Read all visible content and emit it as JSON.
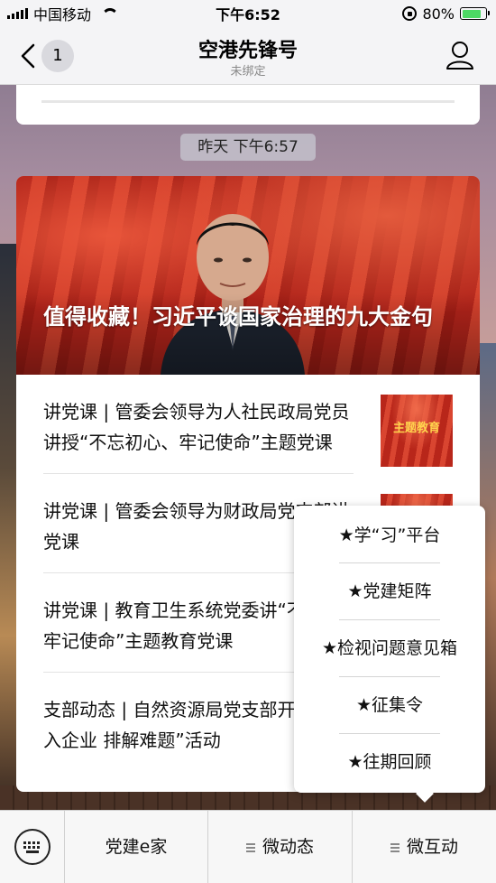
{
  "status_bar": {
    "carrier": "中国移动",
    "time": "下午6:52",
    "battery": "80%",
    "battery_level": 0.8
  },
  "nav": {
    "back_badge": "1",
    "title": "空港先锋号",
    "subtitle": "未绑定"
  },
  "timestamp": "昨天 下午6:57",
  "article": {
    "hero_title": "值得收藏！习近平谈国家治理的九大金句",
    "items": [
      {
        "title": "讲党课 | 管委会领导为人社民政局党员讲授“不忘初心、牢记使命”主题党课",
        "thumb_label": "主题教育"
      },
      {
        "title": "讲党课 | 管委会领导为财政局党支部讲党课",
        "thumb_label": ""
      },
      {
        "title": "讲党课 | 教育卫生系统党委讲“不忘初心 牢记使命”主题教育党课",
        "thumb_label": ""
      },
      {
        "title": "支部动态 | 自然资源局党支部开展 “深入企业 排解难题”活动",
        "thumb_label": ""
      }
    ]
  },
  "popup_menu": {
    "items": [
      "★学“习”平台",
      "★党建矩阵",
      "★检视问题意见箱",
      "★征集令",
      "★往期回顾"
    ]
  },
  "bottom_bar": {
    "tabs": [
      "党建e家",
      "微动态",
      "微互动"
    ]
  }
}
